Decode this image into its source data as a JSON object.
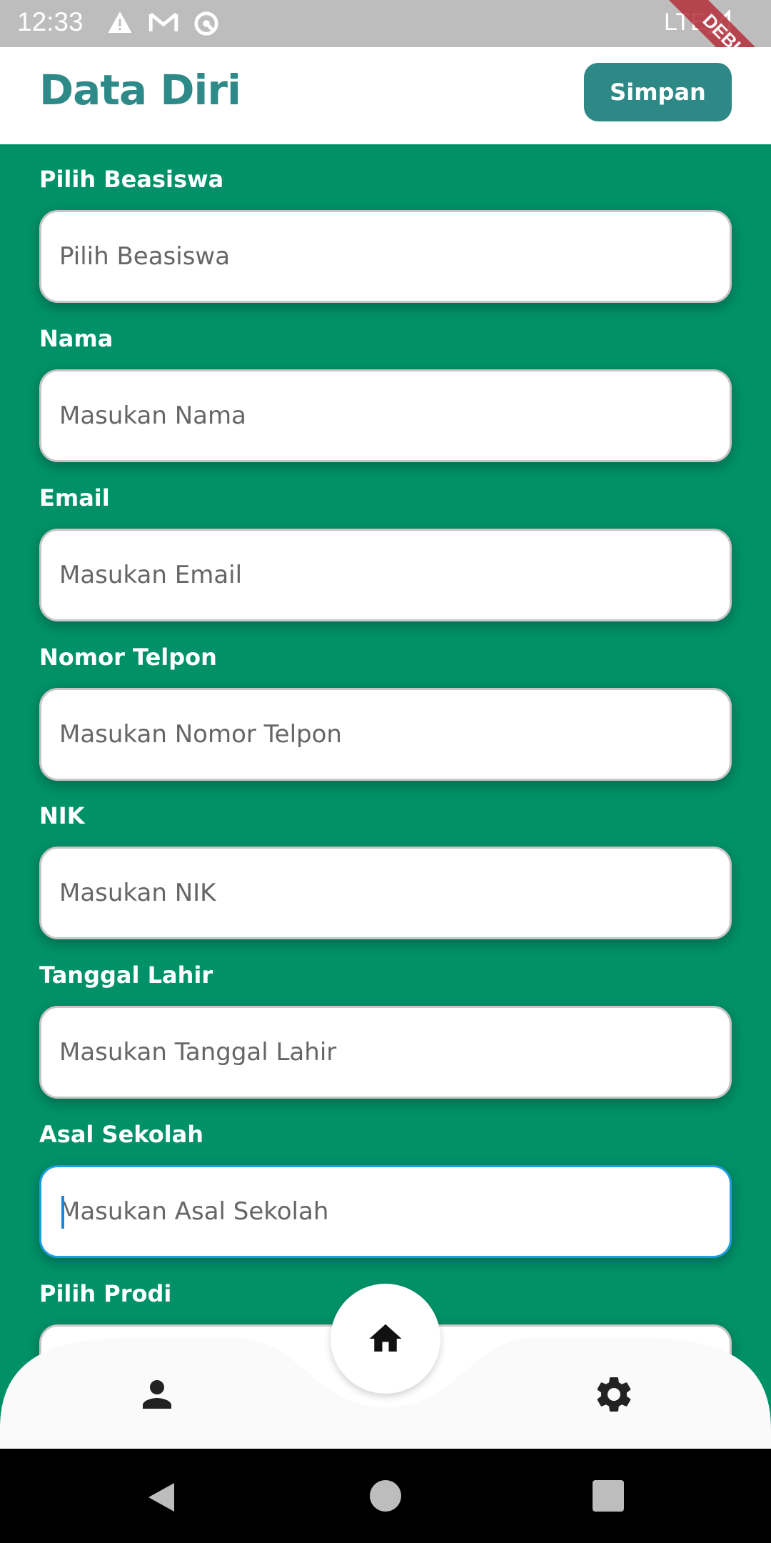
{
  "status_bar": {
    "time": "12:33",
    "network": "LTE",
    "icons": [
      "warning-icon",
      "gmail-icon",
      "sync-icon",
      "signal-icon"
    ]
  },
  "debug_banner": "DEBUG",
  "app_bar": {
    "title": "Data Diri",
    "save_label": "Simpan"
  },
  "form": {
    "fields": [
      {
        "label": "Pilih Beasiswa",
        "placeholder": "Pilih Beasiswa"
      },
      {
        "label": "Nama",
        "placeholder": "Masukan Nama"
      },
      {
        "label": "Email",
        "placeholder": "Masukan Email"
      },
      {
        "label": "Nomor Telpon",
        "placeholder": "Masukan Nomor Telpon"
      },
      {
        "label": "NIK",
        "placeholder": "Masukan NIK"
      },
      {
        "label": "Tanggal Lahir",
        "placeholder": "Masukan Tanggal Lahir"
      },
      {
        "label": "Asal Sekolah",
        "placeholder": "Masukan Asal Sekolah",
        "focused": true
      },
      {
        "label": "Pilih Prodi",
        "placeholder": ""
      }
    ]
  },
  "bottom_nav": {
    "items": [
      "person-icon",
      "home-icon",
      "gear-icon"
    ],
    "selected": "home-icon"
  },
  "system_nav": [
    "back-icon",
    "home-circle-icon",
    "recents-icon"
  ],
  "colors": {
    "background": "#009168",
    "accent": "#2e8886",
    "focus": "#1f9de2"
  }
}
